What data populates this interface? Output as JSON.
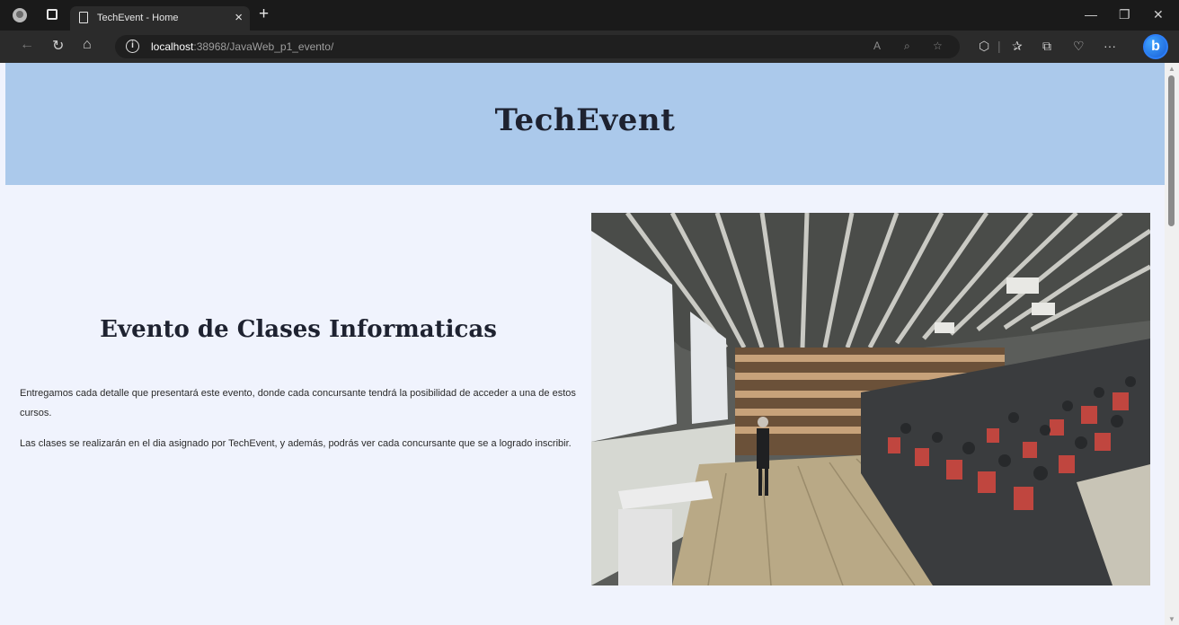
{
  "browser": {
    "tab_title": "TechEvent - Home",
    "tab_close": "×",
    "new_tab": "+",
    "url_host": "localhost",
    "url_rest": ":38968/JavaWeb_p1_evento/",
    "window_controls": {
      "minimize": "—",
      "restore": "❐",
      "close": "✕"
    },
    "icons": [
      "profile-avatar-icon",
      "tab-actions-icon",
      "page-icon",
      "back-icon",
      "refresh-icon",
      "home-icon",
      "site-info-icon",
      "read-aloud-icon",
      "zoom-icon",
      "favorite-icon",
      "extensions-icon",
      "favorites-icon",
      "collections-icon",
      "performance-icon",
      "more-icon",
      "bing-icon"
    ]
  },
  "header": {
    "site_title": "TechEvent"
  },
  "main": {
    "heading": "Evento de Clases Informaticas",
    "paragraph_1": "Entregamos cada detalle que presentará este evento, donde cada concursante tendrá la posibilidad de acceder a una de estos cursos.",
    "paragraph_2": "Las clases se realizarán en el dia asignado por TechEvent, y además, podrás ver cada concursante que se a logrado inscribir."
  },
  "colors": {
    "banner": "#abc9eb",
    "page_bg": "#f0f3fd",
    "title_text": "#1e2230"
  }
}
